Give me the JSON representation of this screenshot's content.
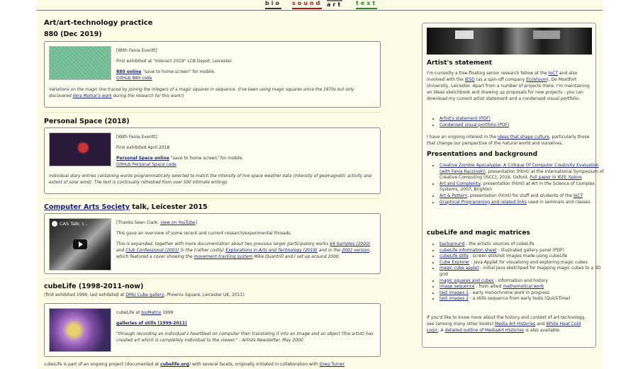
{
  "nav": {
    "bio": "bio",
    "sound": "sound",
    "art": "art",
    "text": "text"
  },
  "page_title": "Art/art-technology practice",
  "works": [
    {
      "title": "880 (Dec 2019)",
      "collab": "[With Fania Everitt]",
      "exhibited": "First exhibited at \"Interact 2019\" LCB Depot, Leicester.",
      "online_link": "880 online",
      "online_suffix": " \"save to home screen\" for mobile.",
      "code_link": "GitHub 880 code",
      "desc_prefix": "Variations on the magic line traced by joining the integers of a magic squares in sequence. (I've been using magic squares since the 1970s but only discovered ",
      "desc_link": "Vera Molnar's work",
      "desc_suffix": " during the research for this work!)"
    },
    {
      "title": "Personal Space (2018)",
      "collab": "[With Fania Everitt]",
      "exhibited": "First exhibited April 2018",
      "online_link": "Personal Space online",
      "online_suffix": " \"save to home screen\" for mobile.",
      "code_link": "GitHub Personal Space code",
      "desc": "individual diary entries containing words programmatically selected to match the intensity of live space weather data (intensity of geomagnetic activity and extent of solar wind). The text is continually refreshed from over 500 intimate writings"
    }
  ],
  "talk": {
    "title_link": "Computer Arts Society",
    "title_rest": " talk, Leicester 2015",
    "video_title": "CAS Talk: I...",
    "thanks_prefix": "[Thanks Sean Clark: ",
    "thanks_link": "view on YouTube",
    "thanks_suffix": "]",
    "overview": "This gave an overview of some recent and current research/experimental threads.",
    "exp_1": "This is expanded, together with more documentation about two previous larger participatory works ",
    "exp_link1": "64 Samples (2000)",
    "exp_2": " and ",
    "exp_link2": "Club Confessional (2001)",
    "exp_3": " in the (rather costly) ",
    "exp_link3": "Explorations in Arts and Technology (2018)",
    "exp_4": " and in the ",
    "exp_link4": "2002 version",
    "exp_5": ", which featured a cover showing the ",
    "exp_link5": "movement-tracking system",
    "exp_6": " Mike Quantrill and I set up around 2000."
  },
  "cubelife": {
    "title": "cubeLife (1998-2011-now)",
    "subtitle_prefix": "(first exhibited 1999, last exhibited at ",
    "subtitle_link": "DMU Cube gallery",
    "subtitle_suffix": ", Phoenix Square, Leicester UK, 2011)",
    "at_prefix": "cubeLife at ",
    "at_link": "bioMatrix",
    "at_suffix": " 1999",
    "galleries_link": "galleries of stills (1999-2011)",
    "quote": "\"through recording an individual's heartbeat on computer then translating it into an image and an object (the artist) has created art which is completely individual to the viewer.\" - Artists Newsletter, May 2000",
    "footer_prefix": "cubeLife is part of an ongoing project (documented at ",
    "footer_link": "cubelife.org",
    "footer_mid": ") with several facets, originally initiated in collaboration with ",
    "footer_link2": "Greg Turner"
  },
  "sidebar": {
    "statement_heading": "Artist's statement",
    "statement_1": "I'm currently a free-floating senior research fellow at the ",
    "statement_link1": "IoCT",
    "statement_2": " and also involved with the ",
    "statement_link2": "IESD",
    "statement_3": " (as a spin-off company ",
    "statement_link3": "EcoVisum",
    "statement_4": "), De Montfort University, Leicester. Apart from a number of projects there, I'm maintaining an ideas sketchbook and drawing up proposals for new projects - you can download my current artist statement and a condensed visual portfolio:",
    "downloads": [
      "Artist's statement (PDF)",
      "Condensed visual portfolio (PDF)"
    ],
    "interest_1": "I have an ongoing interest in the ",
    "interest_link": "ideas that shape culture",
    "interest_2": ", particularly those that change our perspective of the natural world and ourselves.",
    "presentations_heading": "Presentations and background",
    "pres1_link": "Creative Zombie Apocalypse: A Critique Of Computer Creativity Evaluation (with Fania Raczinski)",
    "pres1_text": ", presentation (html) at the International Symposium of Creative Computing (ISCC), 2016, Oxford. ",
    "pres1_link2": "Full paper in IEEE Xplore",
    "pres2_link": "Art and Complexity",
    "pres2_text": ", presentation (html) at Art in the Science of Complex Systems, 2007, Brighton",
    "pres3_link": "Art & Pattern",
    "pres3_text": ", presentation (html) for staff and students of the ",
    "pres3_link2": "IoCT",
    "pres4_link": "Graphical Programming and related links",
    "pres4_text": " used in seminars and classes",
    "cubelife_heading": "cubeLife and magic matrices",
    "cube_items": [
      {
        "link": "background",
        "text": " : the artistic sources of cubeLife"
      },
      {
        "link": "cubeLife information sheet",
        "text": " : illustrated gallery panel (PDF)"
      },
      {
        "link": "cubeLife stills",
        "text": " : screen stillshot images made using cubeLife"
      },
      {
        "link": "Cube Explorer",
        "text": " : Java Applet for visualising and exploring magic cubes"
      },
      {
        "link": "magic cube applet",
        "text": " : initial Java sketchpad for mapping magic cubes to a 3D grid"
      },
      {
        "link": "magic squares and cubes",
        "text": " : information and history"
      },
      {
        "link": "image sequence",
        "text": " : from allied "
      },
      {
        "link": "test images 1",
        "text": " : early monochrome work in progress"
      },
      {
        "link": "test images 2",
        "text": " : a stills sequence from early tests (QuickTime)"
      }
    ],
    "image_seq_link2": "mathematical work",
    "more_1": "If you'd like to know more about the history and context of art-technology, see (among many other books) ",
    "more_link1": "Media Art Histories",
    "more_2": " and ",
    "more_link2": "White Heat Cold Logic",
    "more_3": ". A ",
    "more_link3": "detailed outline of MediaArt Histories",
    "more_4": " is also available."
  }
}
